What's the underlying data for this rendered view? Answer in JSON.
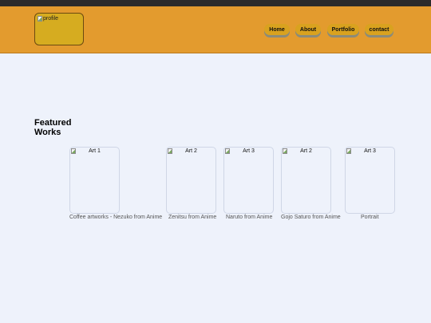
{
  "header": {
    "profile_alt": "profile",
    "nav": [
      {
        "label": "Home"
      },
      {
        "label": "About"
      },
      {
        "label": "Portfolio"
      },
      {
        "label": "contact"
      }
    ],
    "background": "#e39b2e",
    "nav_color": "#d9a21f"
  },
  "main": {
    "title": "Featured Works",
    "works": [
      {
        "alt": "Art 1",
        "caption": "Coffee artworks - Nezuko from Anime"
      },
      {
        "alt": "Art 2",
        "caption": "Zenitsu from Anime"
      },
      {
        "alt": "Art 3",
        "caption": "Naruto from Anime"
      },
      {
        "alt": "Art 2",
        "caption": "Gojo Saturo from Anime"
      },
      {
        "alt": "Art 3",
        "caption": "Portrait"
      }
    ]
  }
}
